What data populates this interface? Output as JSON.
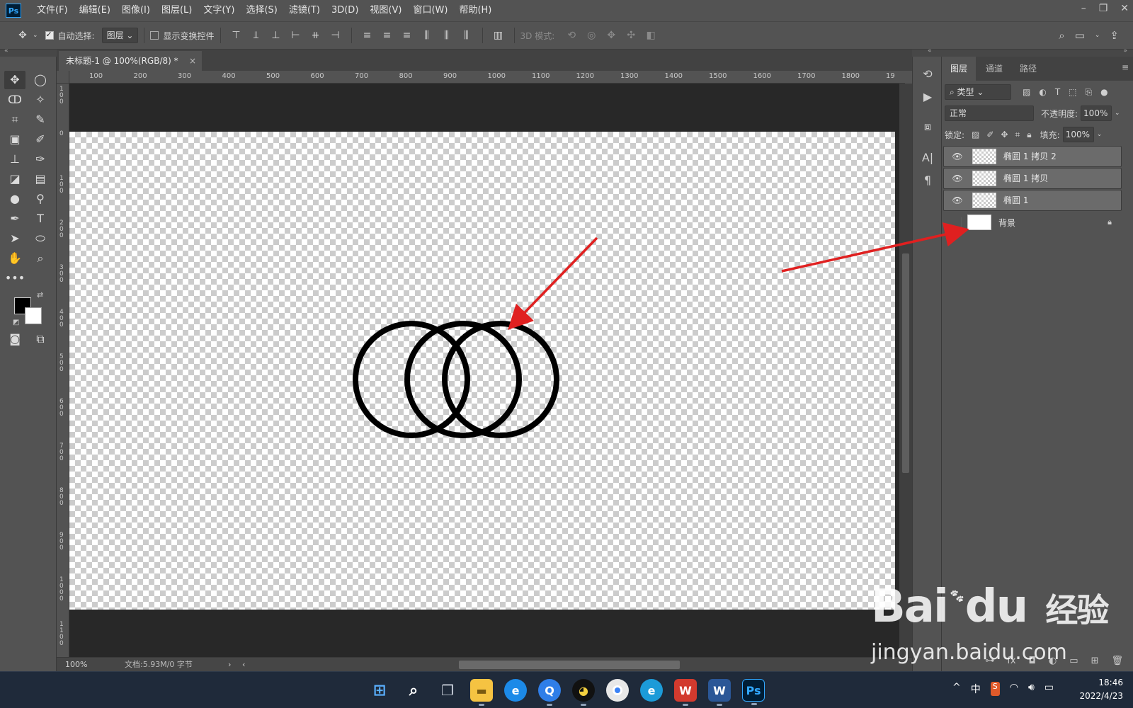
{
  "app": {
    "logo_text": "Ps",
    "menu": [
      "文件(F)",
      "编辑(E)",
      "图像(I)",
      "图层(L)",
      "文字(Y)",
      "选择(S)",
      "滤镜(T)",
      "3D(D)",
      "视图(V)",
      "窗口(W)",
      "帮助(H)"
    ],
    "window_controls": [
      "–",
      "❐",
      "✕"
    ]
  },
  "options_bar": {
    "auto_select_label": "自动选择:",
    "auto_select_checked": true,
    "auto_select_target": "图层",
    "show_transform_label": "显示变换控件",
    "show_transform_checked": false,
    "mode_3d_label": "3D 模式:"
  },
  "document": {
    "tab_title": "未标题-1 @ 100%(RGB/8) *",
    "tab_close": "×",
    "zoom": "100%",
    "doc_info": "文档:5.93M/0 字节",
    "ruler_h": [
      "100",
      "200",
      "300",
      "400",
      "500",
      "600",
      "700",
      "800",
      "900",
      "1000",
      "1100",
      "1200",
      "1300",
      "1400",
      "1500",
      "1600",
      "1700",
      "1800",
      "19"
    ],
    "ruler_v": [
      "1\n0\n0",
      "0",
      "1\n0\n0",
      "2\n0\n0",
      "3\n0\n0",
      "4\n0\n0",
      "5\n0\n0",
      "6\n0\n0",
      "7\n0\n0",
      "8\n0\n0",
      "9\n0\n0",
      "1\n0\n0\n0",
      "1\n1\n0\n0"
    ]
  },
  "layers_panel": {
    "tabs": [
      "图层",
      "通道",
      "路径"
    ],
    "active_tab": 0,
    "filter_kind": "类型",
    "blend_mode": "正常",
    "opacity_label": "不透明度:",
    "opacity_value": "100%",
    "lock_label": "锁定:",
    "fill_label": "填充:",
    "fill_value": "100%",
    "layers": [
      {
        "name": "椭圆 1 拷贝 2",
        "visible": true,
        "selected": true,
        "thumb": "transparent"
      },
      {
        "name": "椭圆 1 拷贝",
        "visible": true,
        "selected": true,
        "thumb": "transparent"
      },
      {
        "name": "椭圆 1",
        "visible": true,
        "selected": true,
        "thumb": "transparent"
      },
      {
        "name": "背景",
        "visible": false,
        "selected": false,
        "thumb": "white",
        "locked": true
      }
    ]
  },
  "watermark": {
    "brand": "Bai",
    "brand_suffix": "du",
    "cn": "经验",
    "url": "jingyan.baidu.com"
  },
  "taskbar": {
    "ime": "中",
    "time": "18:46",
    "date": "2022/4/23"
  },
  "colors": {
    "annotation_arrow": "#e02020",
    "ui_bg": "#535353",
    "canvas_stroke": "#000000"
  }
}
